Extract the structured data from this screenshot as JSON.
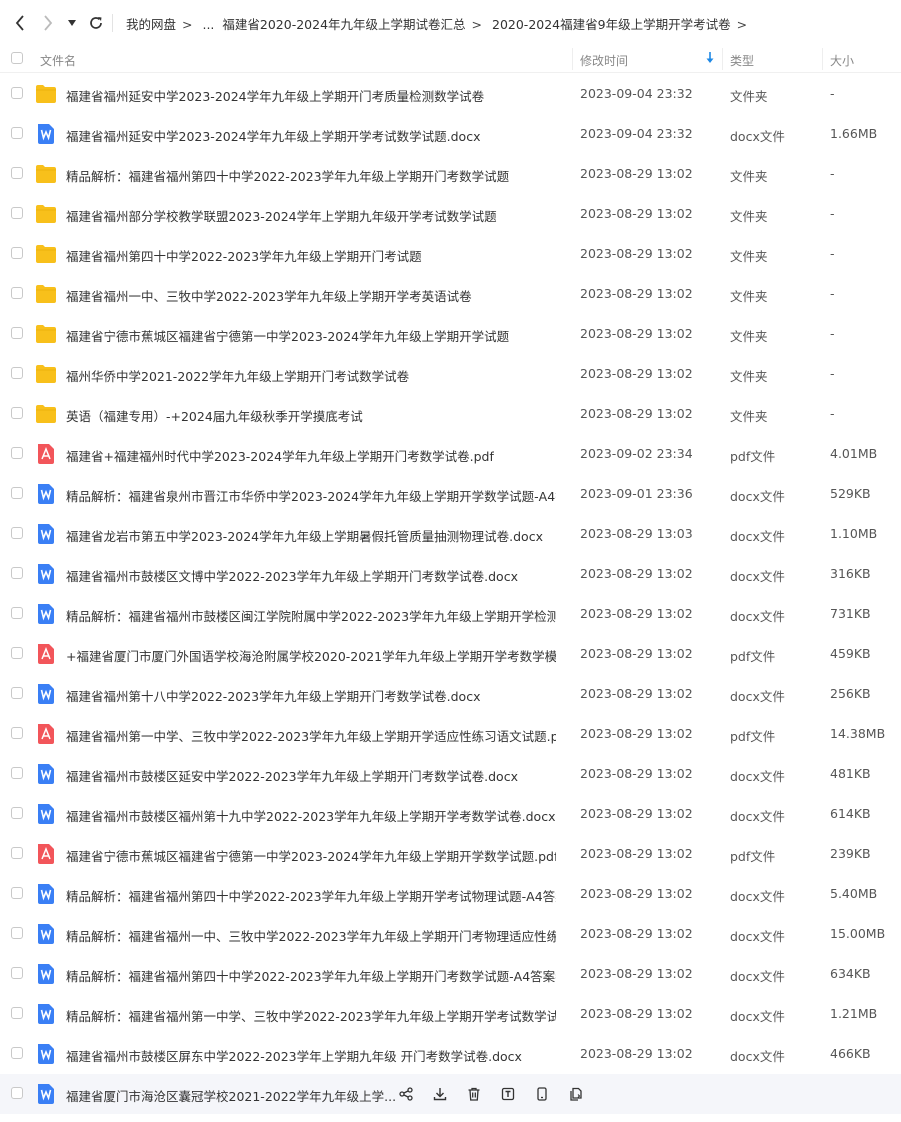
{
  "breadcrumb": [
    "我的网盘",
    "...",
    "福建省2020-2024年九年级上学期试卷汇总",
    "2020-2024福建省9年级上学期开学考试卷"
  ],
  "columns": {
    "name": "文件名",
    "modified": "修改时间",
    "type": "类型",
    "size": "大小"
  },
  "colors": {
    "folder": "#f8c01b",
    "docx": "#3a7ff5",
    "pdf": "#f2555a",
    "accent": "#1e88e5"
  },
  "files": [
    {
      "name": "福建省福州延安中学2023-2024学年九年级上学期开门考质量检测数学试卷",
      "date": "2023-09-04 23:32",
      "type": "文件夹",
      "size": "-",
      "icon": "folder-icon"
    },
    {
      "name": "福建省福州延安中学2023-2024学年九年级上学期开学考试数学试题.docx",
      "date": "2023-09-04 23:32",
      "type": "docx文件",
      "size": "1.66MB",
      "icon": "docx-icon"
    },
    {
      "name": "精品解析：福建省福州第四十中学2022-2023学年九年级上学期开门考数学试题",
      "date": "2023-08-29 13:02",
      "type": "文件夹",
      "size": "-",
      "icon": "folder-icon"
    },
    {
      "name": "福建省福州部分学校教学联盟2023-2024学年上学期九年级开学考试数学试题",
      "date": "2023-08-29 13:02",
      "type": "文件夹",
      "size": "-",
      "icon": "folder-icon"
    },
    {
      "name": "福建省福州第四十中学2022-2023学年九年级上学期开门考试题",
      "date": "2023-08-29 13:02",
      "type": "文件夹",
      "size": "-",
      "icon": "folder-icon"
    },
    {
      "name": "福建省福州一中、三牧中学2022-2023学年九年级上学期开学考英语试卷",
      "date": "2023-08-29 13:02",
      "type": "文件夹",
      "size": "-",
      "icon": "folder-icon"
    },
    {
      "name": "福建省宁德市蕉城区福建省宁德第一中学2023-2024学年九年级上学期开学试题",
      "date": "2023-08-29 13:02",
      "type": "文件夹",
      "size": "-",
      "icon": "folder-icon"
    },
    {
      "name": "福州华侨中学2021-2022学年九年级上学期开门考试数学试卷",
      "date": "2023-08-29 13:02",
      "type": "文件夹",
      "size": "-",
      "icon": "folder-icon"
    },
    {
      "name": "英语（福建专用）-+2024届九年级秋季开学摸底考试",
      "date": "2023-08-29 13:02",
      "type": "文件夹",
      "size": "-",
      "icon": "folder-icon"
    },
    {
      "name": "福建省+福建福州时代中学2023-2024学年九年级上学期开门考数学试卷.pdf",
      "date": "2023-09-02 23:34",
      "type": "pdf文件",
      "size": "4.01MB",
      "icon": "pdf-icon"
    },
    {
      "name": "精品解析：福建省泉州市晋江市华侨中学2023-2024学年九年级上学期开学数学试题-A4答...",
      "date": "2023-09-01 23:36",
      "type": "docx文件",
      "size": "529KB",
      "icon": "docx-icon"
    },
    {
      "name": "福建省龙岩市第五中学2023-2024学年九年级上学期暑假托管质量抽测物理试卷.docx",
      "date": "2023-08-29 13:03",
      "type": "docx文件",
      "size": "1.10MB",
      "icon": "docx-icon"
    },
    {
      "name": "福建省福州市鼓楼区文博中学2022-2023学年九年级上学期开门考数学试卷.docx",
      "date": "2023-08-29 13:02",
      "type": "docx文件",
      "size": "316KB",
      "icon": "docx-icon"
    },
    {
      "name": "精品解析：福建省福州市鼓楼区闽江学院附属中学2022-2023学年九年级上学期开学检测数...",
      "date": "2023-08-29 13:02",
      "type": "docx文件",
      "size": "731KB",
      "icon": "docx-icon"
    },
    {
      "name": "+福建省厦门市厦门外国语学校海沧附属学校2020-2021学年九年级上学期开学考数学模拟...",
      "date": "2023-08-29 13:02",
      "type": "pdf文件",
      "size": "459KB",
      "icon": "pdf-icon"
    },
    {
      "name": "福建省福州第十八中学2022-2023学年九年级上学期开门考数学试卷.docx",
      "date": "2023-08-29 13:02",
      "type": "docx文件",
      "size": "256KB",
      "icon": "docx-icon"
    },
    {
      "name": "福建省福州第一中学、三牧中学2022-2023学年九年级上学期开学适应性练习语文试题.pdf",
      "date": "2023-08-29 13:02",
      "type": "pdf文件",
      "size": "14.38MB",
      "icon": "pdf-icon"
    },
    {
      "name": "福建省福州市鼓楼区延安中学2022-2023学年九年级上学期开门考数学试卷.docx",
      "date": "2023-08-29 13:02",
      "type": "docx文件",
      "size": "481KB",
      "icon": "docx-icon"
    },
    {
      "name": "福建省福州市鼓楼区福州第十九中学2022-2023学年九年级上学期开学考数学试卷.docx",
      "date": "2023-08-29 13:02",
      "type": "docx文件",
      "size": "614KB",
      "icon": "docx-icon"
    },
    {
      "name": "福建省宁德市蕉城区福建省宁德第一中学2023-2024学年九年级上学期开学数学试题.pdf",
      "date": "2023-08-29 13:02",
      "type": "pdf文件",
      "size": "239KB",
      "icon": "pdf-icon"
    },
    {
      "name": "精品解析：福建省福州第四十中学2022-2023学年九年级上学期开学考试物理试题-A4答案...",
      "date": "2023-08-29 13:02",
      "type": "docx文件",
      "size": "5.40MB",
      "icon": "docx-icon"
    },
    {
      "name": "精品解析：福建省福州一中、三牧中学2022-2023学年九年级上学期开门考物理适应性练习...",
      "date": "2023-08-29 13:02",
      "type": "docx文件",
      "size": "15.00MB",
      "icon": "docx-icon"
    },
    {
      "name": "精品解析：福建省福州第四十中学2022-2023学年九年级上学期开门考数学试题-A4答案卷...",
      "date": "2023-08-29 13:02",
      "type": "docx文件",
      "size": "634KB",
      "icon": "docx-icon"
    },
    {
      "name": "精品解析：福建省福州第一中学、三牧中学2022-2023学年九年级上学期开学考试数学试卷-...",
      "date": "2023-08-29 13:02",
      "type": "docx文件",
      "size": "1.21MB",
      "icon": "docx-icon"
    },
    {
      "name": "福建省福州市鼓楼区屏东中学2022-2023学年上学期九年级 开门考数学试卷.docx",
      "date": "2023-08-29 13:02",
      "type": "docx文件",
      "size": "466KB",
      "icon": "docx-icon"
    }
  ],
  "hover_row": {
    "name": "福建省厦门市海沧区囊冠学校2021-2022学年九年级上学...",
    "icon": "docx-icon",
    "actions": [
      "share-icon",
      "download-icon",
      "delete-icon",
      "rename-icon",
      "phone-icon",
      "copy-icon"
    ]
  }
}
